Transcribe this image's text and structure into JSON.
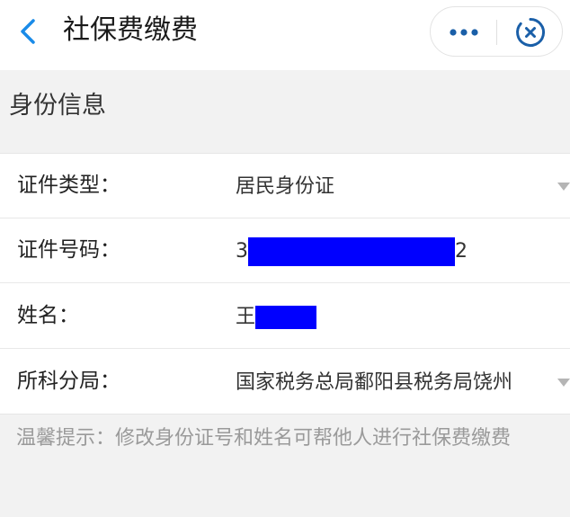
{
  "header": {
    "title": "社保费缴费",
    "back_icon": "chevron-left-icon",
    "more_icon": "more-dots-icon",
    "close_icon": "mini-program-close-icon",
    "accent_color": "#1a8be8"
  },
  "section": {
    "title": "身份信息"
  },
  "form": {
    "id_type": {
      "label": "证件类型：",
      "value": "居民身份证",
      "icon": "dropdown-arrow-icon"
    },
    "id_number": {
      "label": "证件号码：",
      "value_prefix": "3",
      "value_suffix": "2",
      "redaction_color": "#0000ff"
    },
    "name": {
      "label": "姓名：",
      "value_prefix": "王",
      "redaction_color": "#0000ff"
    },
    "tax_bureau": {
      "label": "所科分局：",
      "value": "国家税务总局鄱阳县税务局饶州",
      "icon": "dropdown-arrow-icon"
    }
  },
  "tip": {
    "text": "温馨提示：修改身份证号和姓名可帮他人进行社保费缴费"
  }
}
